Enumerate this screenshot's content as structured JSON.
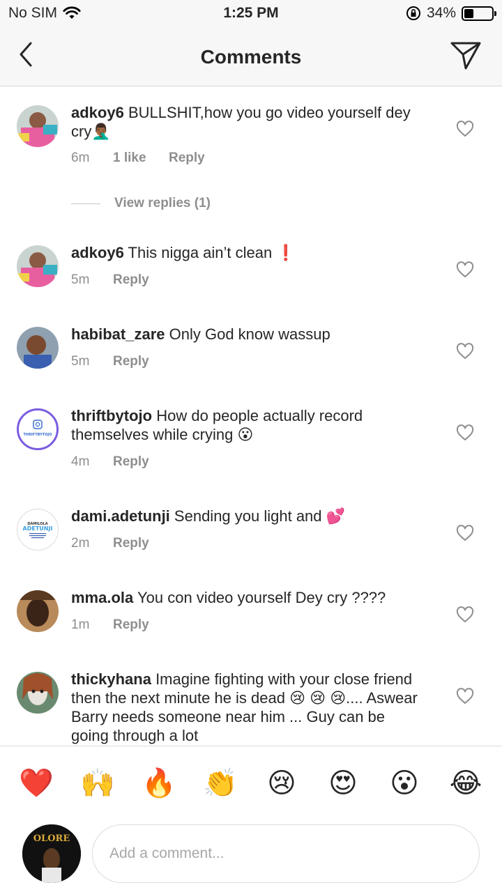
{
  "status": {
    "carrier": "No SIM",
    "time": "1:25 PM",
    "battery": "34%",
    "battery_level": 0.34
  },
  "nav": {
    "title": "Comments"
  },
  "comments": [
    {
      "username": "adkoy6",
      "text": "BULLSHIT,how you go video yourself dey cry🤦🏾‍♂️",
      "time": "6m",
      "likes": "1 like",
      "reply": "Reply",
      "view_replies": "View replies (1)"
    },
    {
      "username": "adkoy6",
      "text": "This nigga ain’t clean ❗",
      "time": "5m",
      "reply": "Reply"
    },
    {
      "username": "habibat_zare",
      "text": "Only God know wassup",
      "time": "5m",
      "reply": "Reply"
    },
    {
      "username": "thriftbytojo",
      "text": "How do people actually record themselves while crying 😮",
      "time": "4m",
      "reply": "Reply",
      "avatar_text": "THRIFTBYTOJO"
    },
    {
      "username": "dami.adetunji",
      "text": "Sending you light and 💕",
      "time": "2m",
      "reply": "Reply",
      "avatar_text_top": "DAMILOLA",
      "avatar_text_bottom": "ADETUNJI"
    },
    {
      "username": "mma.ola",
      "text": "You con video yourself Dey cry ????",
      "time": "1m",
      "reply": "Reply"
    },
    {
      "username": "thickyhana",
      "text": "Imagine fighting with your close friend  then the next minute he is dead 😢 😢 😢.... Aswear Barry needs someone near him ... Guy can be  going through a lot"
    }
  ],
  "emoji_bar": [
    "❤️",
    "🙌",
    "🔥",
    "👏",
    "😢",
    "😍",
    "😮",
    "😂"
  ],
  "composer": {
    "placeholder": "Add a comment...",
    "avatar_text": "OLORE"
  },
  "colors": {
    "text": "#262626",
    "secondary": "#8e8e8e",
    "bar": "#f7f7f7",
    "divider": "#d6d6d6"
  }
}
